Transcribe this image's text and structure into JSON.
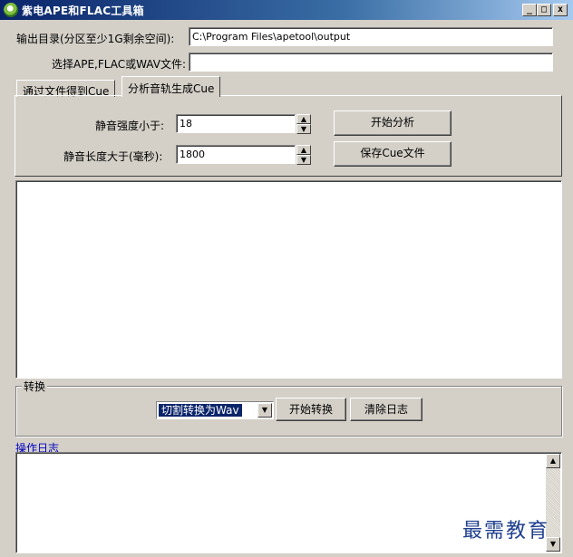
{
  "window": {
    "title": "紫电APE和FLAC工具箱",
    "controls": {
      "minimize": "_",
      "maximize": "□",
      "close": "x"
    }
  },
  "output_dir": {
    "label": "输出目录(分区至少1G剩余空间):",
    "value": "C:\\Program Files\\apetool\\output"
  },
  "select_file": {
    "label": "选择APE,FLAC或WAV文件:",
    "value": ""
  },
  "tabs": [
    {
      "label": "通过文件得到Cue",
      "active": false
    },
    {
      "label": "分析音轨生成Cue",
      "active": true
    }
  ],
  "analysis": {
    "silence_strength_label": "静音强度小于:",
    "silence_strength_value": "18",
    "silence_length_label": "静音长度大于(毫秒):",
    "silence_length_value": "1800",
    "start_analysis_button": "开始分析",
    "save_cue_button": "保存Cue文件",
    "spin_up": "▲",
    "spin_down": "▼"
  },
  "convert": {
    "group_title": "转换",
    "mode_selected": "切割转换为Wav",
    "dropdown_arrow": "▼",
    "start_convert_button": "开始转换",
    "clear_log_button": "清除日志"
  },
  "log": {
    "label": "操作日志",
    "scroll_up": "▲",
    "scroll_down": "▼"
  },
  "watermark": "最需教育"
}
